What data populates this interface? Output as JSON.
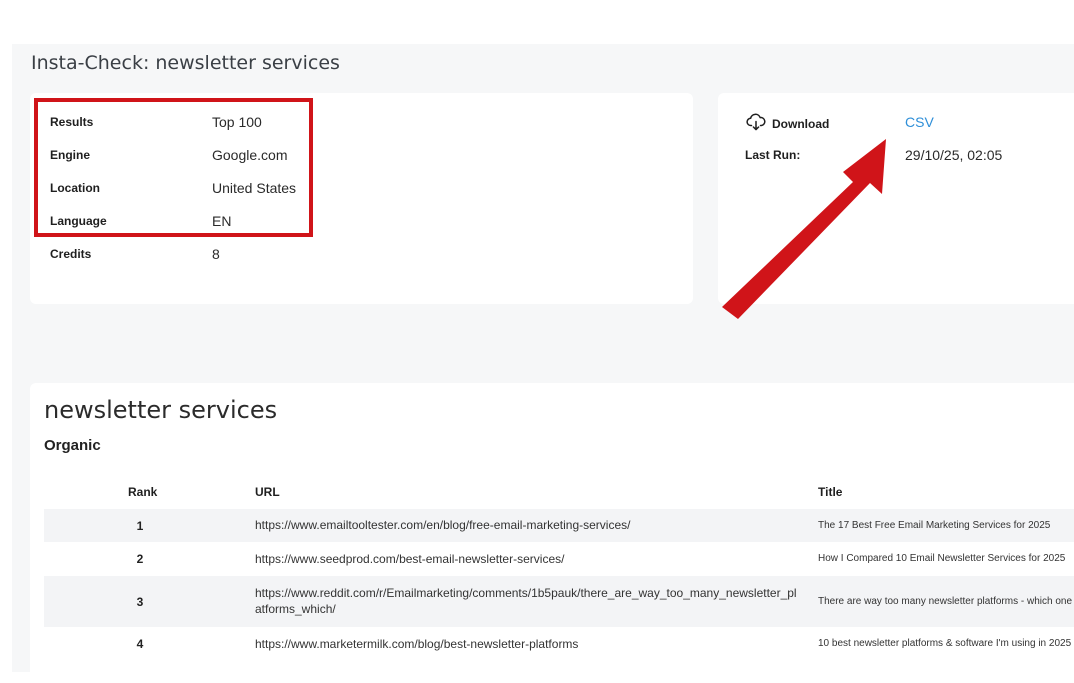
{
  "page": {
    "title": "Insta-Check: newsletter services"
  },
  "details": {
    "rows": [
      {
        "label": "Results",
        "value": "Top 100"
      },
      {
        "label": "Engine",
        "value": "Google.com"
      },
      {
        "label": "Location",
        "value": "United States"
      },
      {
        "label": "Language",
        "value": "EN"
      },
      {
        "label": "Credits",
        "value": "8"
      }
    ]
  },
  "download": {
    "label": "Download",
    "icon": "cloud-download-icon",
    "csv_label": "CSV",
    "last_run_label": "Last Run:",
    "last_run_value": "29/10/25, 02:05"
  },
  "annotations": {
    "highlight_color": "#d01419",
    "arrow_color": "#d01419"
  },
  "results": {
    "query_title": "newsletter services",
    "section": "Organic",
    "columns": {
      "rank": "Rank",
      "url": "URL",
      "title": "Title"
    },
    "rows": [
      {
        "rank": "1",
        "url": "https://www.emailtooltester.com/en/blog/free-email-marketing-services/",
        "title": "The 17 Best Free Email Marketing Services for 2025"
      },
      {
        "rank": "2",
        "url": "https://www.seedprod.com/best-email-newsletter-services/",
        "title": "How I Compared 10 Email Newsletter Services for 2025"
      },
      {
        "rank": "3",
        "url": "https://www.reddit.com/r/Emailmarketing/comments/1b5pauk/there_are_way_too_many_newsletter_platforms_which/",
        "title": "There are way too many newsletter platforms - which one ..."
      },
      {
        "rank": "4",
        "url": "https://www.marketermilk.com/blog/best-newsletter-platforms",
        "title": "10 best newsletter platforms & software I'm using in 2025"
      }
    ]
  }
}
